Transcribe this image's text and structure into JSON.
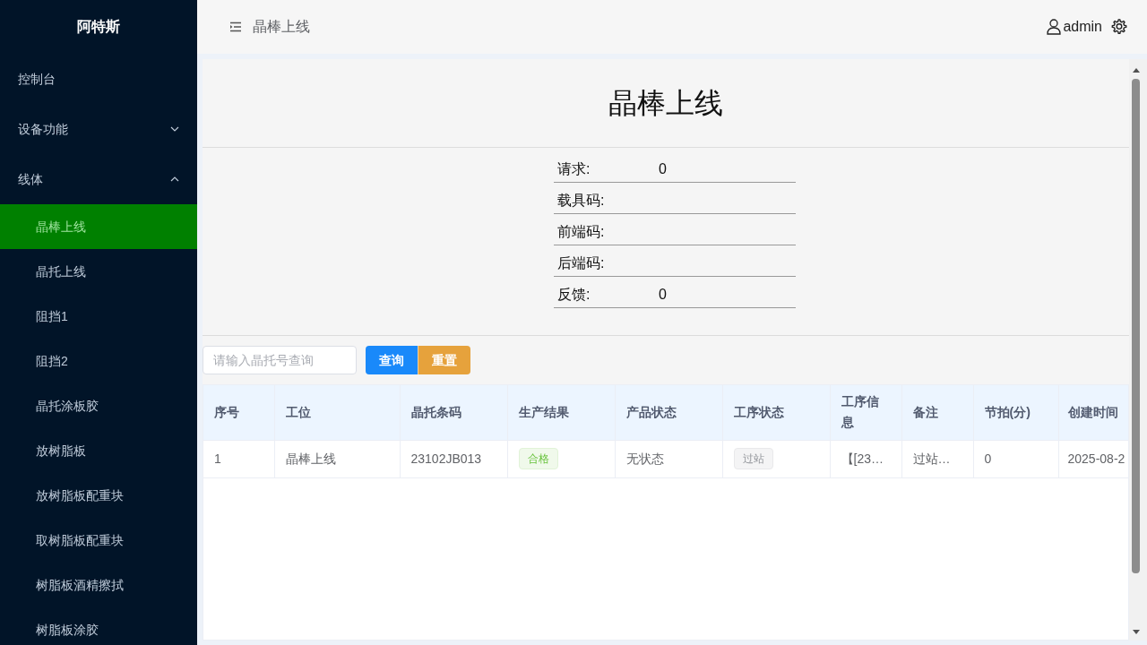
{
  "sidebar": {
    "logo": "阿特斯",
    "items": [
      {
        "label": "控制台",
        "kind": "item",
        "selected": false
      },
      {
        "label": "设备功能",
        "kind": "submenu",
        "expanded": false,
        "selected": false
      },
      {
        "label": "线体",
        "kind": "submenu",
        "expanded": true,
        "selected": false,
        "children": [
          {
            "label": "晶棒上线",
            "selected": true
          },
          {
            "label": "晶托上线",
            "selected": false
          },
          {
            "label": "阻挡1",
            "selected": false
          },
          {
            "label": "阻挡2",
            "selected": false
          },
          {
            "label": "晶托涂板胶",
            "selected": false
          },
          {
            "label": "放树脂板",
            "selected": false
          },
          {
            "label": "放树脂板配重块",
            "selected": false
          },
          {
            "label": "取树脂板配重块",
            "selected": false
          },
          {
            "label": "树脂板酒精擦拭",
            "selected": false
          },
          {
            "label": "树脂板涂胶",
            "selected": false
          }
        ]
      }
    ]
  },
  "header": {
    "breadcrumb": "晶棒上线",
    "user": "admin"
  },
  "page": {
    "title": "晶棒上线",
    "fields": [
      {
        "label": "请求:",
        "value": "0"
      },
      {
        "label": "载具码:"
      },
      {
        "label": "前端码:"
      },
      {
        "label": "后端码:"
      },
      {
        "label": "反馈:",
        "value": "0"
      }
    ]
  },
  "search": {
    "placeholder": "请输入晶托号查询",
    "buttons": [
      {
        "label": "查询",
        "kind": "primary"
      },
      {
        "label": "重置",
        "kind": "warning"
      }
    ]
  },
  "table": {
    "columns": [
      "序号",
      "工位",
      "晶托条码",
      "生产结果",
      "产品状态",
      "工序状态",
      "工序信息",
      "备注",
      "节拍(分)",
      "创建时间"
    ],
    "rows": [
      {
        "cells": [
          {
            "kind": "text",
            "text": "1"
          },
          {
            "kind": "text",
            "text": "晶棒上线"
          },
          {
            "kind": "text",
            "text": "23102JB013"
          },
          {
            "kind": "tag",
            "color": "#67c23a",
            "text": "合格"
          },
          {
            "kind": "text",
            "text": "无状态"
          },
          {
            "kind": "tag",
            "color": "#909399",
            "text": "过站"
          },
          {
            "kind": "text",
            "text": "【[23…"
          },
          {
            "kind": "text",
            "text": "过站…"
          },
          {
            "kind": "text",
            "text": "0"
          },
          {
            "kind": "text",
            "text": "2025-08-2"
          }
        ]
      }
    ]
  }
}
